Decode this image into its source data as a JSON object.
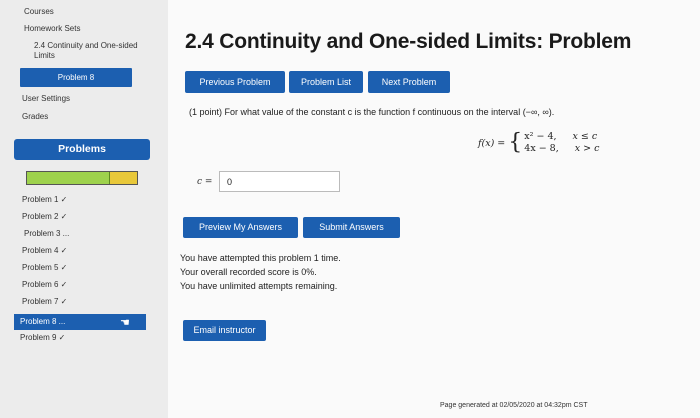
{
  "sidebar": {
    "courses": "Courses",
    "homework_sets": "Homework Sets",
    "section": "2.4 Continuity and One-sided Limits",
    "current_problem": "Problem 8",
    "user_settings": "User Settings",
    "grades": "Grades",
    "problems_header": "Problems",
    "progress_fraction": 0.75,
    "problem_list": [
      "Problem 1 ✓",
      "Problem 2 ✓",
      "Problem 3 ...",
      "Problem 4 ✓",
      "Problem 5 ✓",
      "Problem 6 ✓",
      "Problem 7 ✓",
      "Problem 8 ...",
      "Problem 9 ✓"
    ]
  },
  "main": {
    "title": "2.4 Continuity and One-sided Limits: Problem",
    "nav_buttons": {
      "previous": "Previous Problem",
      "list": "Problem List",
      "next": "Next Problem"
    },
    "problem": {
      "statement": "(1 point) For what value of the constant c is the function f continuous on the interval (−∞, ∞).",
      "func_name": "f(x) =",
      "case1_expr": "x² − 4,",
      "case1_cond": "x ≤ c",
      "case2_expr": "4x − 8,",
      "case2_cond": "x > c",
      "answer_label": "c =",
      "answer_value": "0"
    },
    "actions": {
      "preview": "Preview My Answers",
      "submit": "Submit Answers"
    },
    "attempt_lines": [
      "You have attempted this problem 1 time.",
      "Your overall recorded score is 0%.",
      "You have unlimited attempts remaining."
    ],
    "email": "Email instructor",
    "footer": "Page generated at 02/05/2020 at 04:32pm CST"
  },
  "colors": {
    "accent": "#1c5fb0",
    "progress_green": "#9ed24d",
    "progress_yellow": "#e8c83a"
  }
}
